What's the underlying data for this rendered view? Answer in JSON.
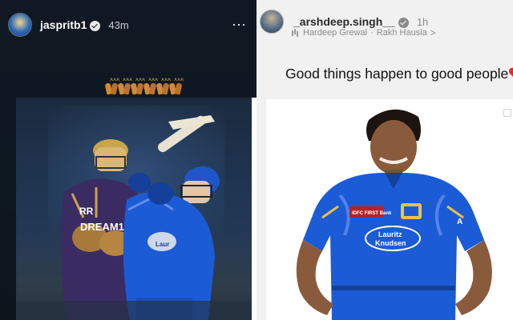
{
  "stories": {
    "left": {
      "username": "jaspritb1",
      "time": "43m",
      "more_label": "···",
      "player1_jersey_brand": "RR",
      "player1_jersey_text": "DREAM1",
      "player2_jersey_text": "Laur"
    },
    "right": {
      "username": "_arshdeep.singh__",
      "time": "1h",
      "music_artist": "Hardeep Grewal",
      "music_separator": "·",
      "music_song": "Rakh Hausla",
      "music_chevron": ">",
      "caption": "Good things happen to good people",
      "jersey_sponsor_top": "IDFC FIRST Bank",
      "jersey_sponsor_main_line1": "Lauritz",
      "jersey_sponsor_main_line2": "Knudsen",
      "sleeve_text": "A"
    }
  },
  "icons": {
    "verified": "verified-badge-icon",
    "more": "more-options-icon",
    "music": "music-note-icon",
    "heart": "red-heart-icon",
    "clap": "clapping-hands-icon"
  },
  "colors": {
    "left_bg": "#0e1821",
    "right_bg": "#f1f1f1",
    "mi_blue": "#1c5bd6",
    "kkr_purple": "#3b2b63",
    "heart_red": "#e52a2a"
  }
}
